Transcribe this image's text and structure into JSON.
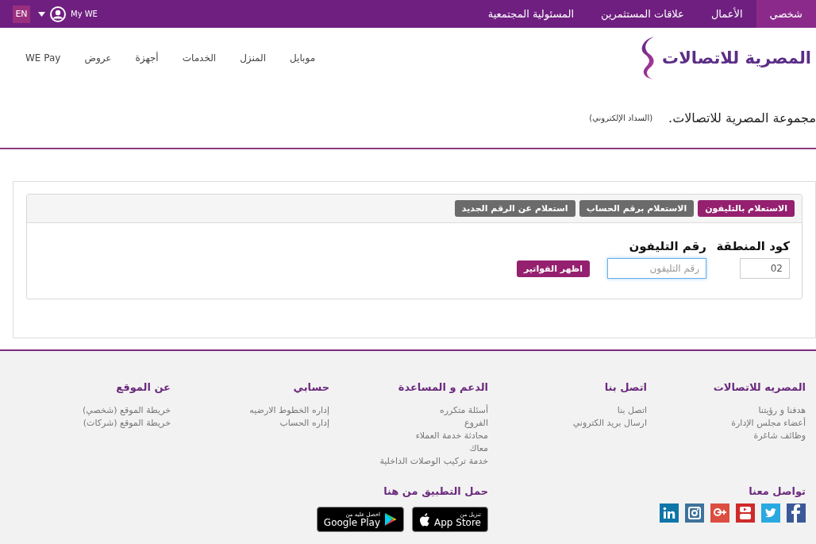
{
  "top_bar": {
    "language": "EN",
    "account": "My WE",
    "tabs": [
      {
        "label": "شخصي",
        "selected": true
      },
      {
        "label": "الأعمال",
        "selected": false
      },
      {
        "label": "علاقات المستثمرين",
        "selected": false
      },
      {
        "label": "المسئولية المجتمعية",
        "selected": false
      }
    ]
  },
  "brand": {
    "name": "المصرية للاتصالات"
  },
  "nav": [
    "موبايل",
    "المنزل",
    "الخدمات",
    "أجهزة",
    "عروض",
    "WE Pay"
  ],
  "page_title": {
    "title": "مجموعة المصرية للاتصالات.",
    "subtitle": "(السداد الإلكتروني)"
  },
  "inquiry": {
    "tabs": [
      {
        "label": "الاستعلام بالتليفون",
        "selected": true
      },
      {
        "label": "الاستعلام برقم الحساب",
        "selected": false
      },
      {
        "label": "استعلام عن الرقم الجديد",
        "selected": false
      }
    ],
    "area_code": {
      "label": "كود المنطقة",
      "value": "02"
    },
    "phone": {
      "label": "رقم التليفون",
      "placeholder": "رقم التليفون"
    },
    "submit": "اظهر الفواتير"
  },
  "footer": {
    "columns": [
      {
        "heading": "المصريه للاتصالات",
        "links": [
          "هدفنا و رؤيتنا",
          "أعضاء مجلس الإدارة",
          "وظائف شاغرة"
        ]
      },
      {
        "heading": "اتصل بنا",
        "links": [
          "اتصل بنا",
          "ارسال بريد الكتروني"
        ]
      },
      {
        "heading": "الدعم و المساعدة",
        "links": [
          "أسئلة متكرره",
          "الفروع",
          "محادثة خدمة العملاء",
          "معاك",
          "خدمة تركيب الوصلات الداخلية"
        ]
      },
      {
        "heading": "حسابي",
        "links": [
          "إداره الخطوط الارضيه",
          "إداره الحساب"
        ]
      },
      {
        "heading": "عن الموقع",
        "links": [
          "خريطة الموقع (شخصي)",
          "خريطة الموقع (شركات)"
        ]
      }
    ],
    "social": {
      "heading": "تواصل معنا"
    },
    "app_download": {
      "heading": "حمل التطبيق من هنا",
      "badges": [
        {
          "kind": "apple",
          "caption": "تنزيل من",
          "store": "App Store"
        },
        {
          "kind": "google_play",
          "caption": "احصل عليه من",
          "store": "Google Play"
        }
      ]
    }
  }
}
